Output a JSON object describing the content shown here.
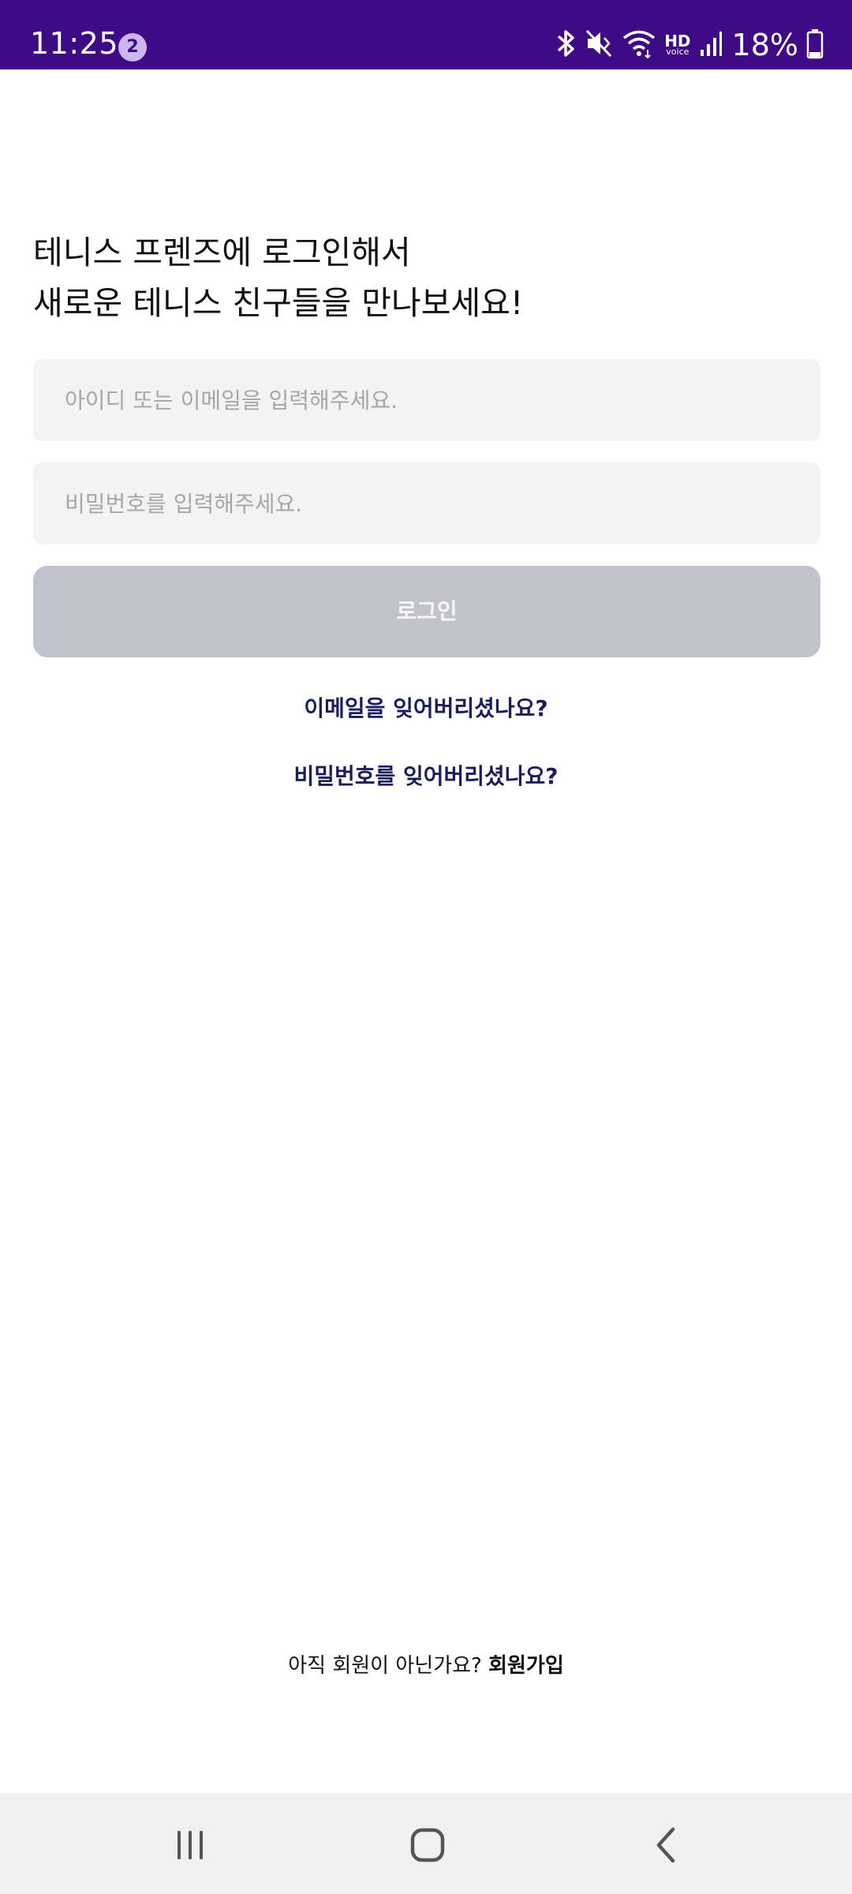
{
  "status_bar": {
    "time": "11:25",
    "notification_count": "2",
    "hd_label": "HD",
    "hd_sub": "voice",
    "battery": "18%",
    "icons": [
      "bluetooth-icon",
      "mute-icon",
      "wifi-icon",
      "hd-voice-icon",
      "signal-icon",
      "battery-icon"
    ]
  },
  "heading": {
    "line1": "테니스 프렌즈에 로그인해서",
    "line2": "새로운 테니스 친구들을 만나보세요!"
  },
  "form": {
    "id_placeholder": "아이디 또는 이메일을 입력해주세요.",
    "id_value": "",
    "password_placeholder": "비밀번호를 입력해주세요.",
    "password_value": "",
    "login_label": "로그인"
  },
  "links": {
    "forgot_email": "이메일을 잊어버리셨나요?",
    "forgot_password": "비밀번호를 잊어버리셨나요?"
  },
  "signup": {
    "prompt": "아직 회원이 아닌가요?",
    "cta": "회원가입"
  },
  "navigation": {
    "icons": [
      "recent-apps-icon",
      "home-icon",
      "back-icon"
    ]
  },
  "colors": {
    "status_bar": "#3f0a86",
    "link": "#1a1e5a",
    "button_disabled": "#c3c3cd",
    "input_bg": "#f3f3f4"
  }
}
